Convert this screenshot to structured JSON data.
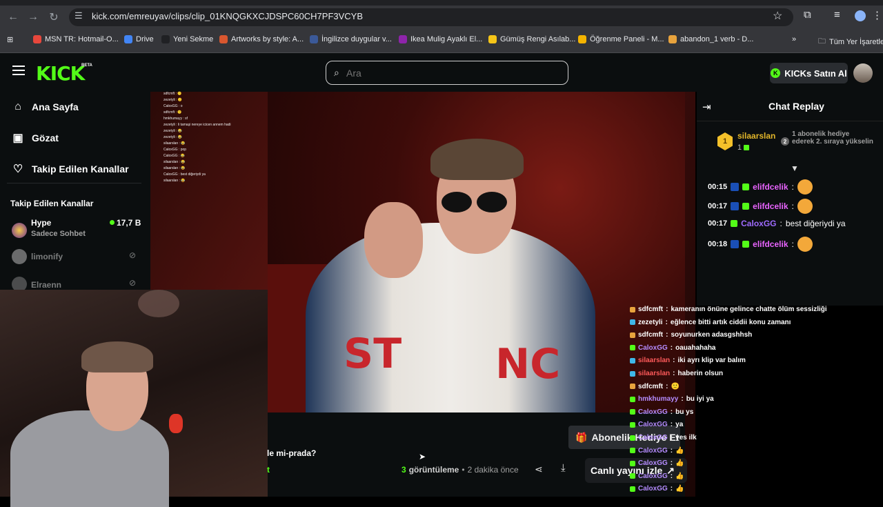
{
  "browser": {
    "url": "kick.com/emreuyav/clips/clip_01KNQGKXCJDSPC60CH7PF3VCYB",
    "bookmarks": [
      {
        "label": "MSN TR: Hotmail-O...",
        "color": "#e7473c"
      },
      {
        "label": "Drive",
        "color": "#4285f4"
      },
      {
        "label": "Yeni Sekme",
        "color": "#202124"
      },
      {
        "label": "Artworks by style: A...",
        "color": "#d9572f"
      },
      {
        "label": "İngilizce duygular v...",
        "color": "#3b5998"
      },
      {
        "label": "Ikea Mulig Ayaklı El...",
        "color": "#8e24aa"
      },
      {
        "label": "Gümüş Rengi Asılab...",
        "color": "#f5c518"
      },
      {
        "label": "Öğrenme Paneli - M...",
        "color": "#f4b400"
      },
      {
        "label": "abandon_1 verb - D...",
        "color": "#e8a33d"
      }
    ],
    "more_bookmarks": "»",
    "all_bookmarks": "Tüm Yer İşaretle"
  },
  "kick": {
    "logo": "KICK",
    "beta": "BETA",
    "search_placeholder": "Ara",
    "kicks_button": "KICKs Satın Al",
    "kicks_icon": "K"
  },
  "sidebar": {
    "items": [
      {
        "label": "Ana Sayfa",
        "icon": "home-icon"
      },
      {
        "label": "Gözat",
        "icon": "browse-icon"
      },
      {
        "label": "Takip Edilen Kanallar",
        "icon": "heart-icon"
      }
    ],
    "section_title": "Takip Edilen Kanallar",
    "channels": [
      {
        "name": "Hype",
        "sub": "Sadece Sohbet",
        "viewers": "17,7 B",
        "live": true
      },
      {
        "name": "limonify",
        "sub": "",
        "viewers": "",
        "live": false
      },
      {
        "name": "Elraenn",
        "sub": "",
        "viewers": "",
        "live": false
      }
    ]
  },
  "clip": {
    "title": "le mi-prada?",
    "extra": "t",
    "views_count": "3",
    "views_label": "görüntüleme",
    "separator": "•",
    "time_ago": "2 dakika önce",
    "watch_live": "Canlı yayını izle",
    "subscribe_button": "Abonelik Hediye Et"
  },
  "mini_chat": [
    "sdfcmft : 😶",
    "zezetyli : 🙂",
    "CaloxGG : o",
    "sdfcmft : 🙂",
    "hmkhumayy : sf",
    "zezetyli : li tamaşi nereye icicen annem hadi",
    "zezetyli : 😂",
    "zezetyli : 😂",
    "silaarslan : 😂",
    "CaloxGG : pop",
    "CaloxGG : 😂",
    "silaarslan : 😂",
    "silaarslan : 😂",
    "CaloxGG : best diğeriydi ya",
    "silaarslan : 😂"
  ],
  "chat": {
    "title": "Chat Replay",
    "gifter": {
      "rank_badge": "1",
      "name": "silaarslan",
      "count": "1",
      "rank": "2",
      "text": "1 abonelik hediye ederek 2. sıraya yükselin"
    },
    "messages": [
      {
        "time": "00:15",
        "user": "elifdcelik",
        "color": "#e964ff",
        "text": ""
      },
      {
        "time": "00:17",
        "user": "elifdcelik",
        "color": "#e964ff",
        "text": ""
      },
      {
        "time": "00:17",
        "user": "CaloxGG",
        "color": "#9f6bff",
        "text": "best diğeriydi ya"
      },
      {
        "time": "00:18",
        "user": "elifdcelik",
        "color": "#e964ff",
        "text": ""
      }
    ]
  },
  "overlay_chat": [
    {
      "user": "sdfcmft",
      "color": "#ffffff",
      "badge": "#e8a33d",
      "text": "kameranın önüne gelince chatte ölüm sessizliği"
    },
    {
      "user": "zezetyli",
      "color": "#ffffff",
      "badge": "#3fb7e8",
      "text": "eğlence bitti artık ciddii konu zamanı"
    },
    {
      "user": "sdfcmft",
      "color": "#ffffff",
      "badge": "#e8a33d",
      "text": "soyunurken adasgshhsh"
    },
    {
      "user": "CaloxGG",
      "color": "#b58cff",
      "badge": "#53fc18",
      "text": "oauahahaha"
    },
    {
      "user": "silaarslan",
      "color": "#ff5a5a",
      "badge": "#3fb7e8",
      "text": "iki ayrı klip var balım"
    },
    {
      "user": "silaarslan",
      "color": "#ff5a5a",
      "badge": "#3fb7e8",
      "text": "haberin olsun"
    },
    {
      "user": "sdfcmft",
      "color": "#ffffff",
      "badge": "#e8a33d",
      "text": "🙂"
    },
    {
      "user": "hmkhumayy",
      "color": "#b58cff",
      "badge": "#53fc18",
      "text": "bu iyi ya"
    },
    {
      "user": "CaloxGG",
      "color": "#b58cff",
      "badge": "#53fc18",
      "text": "bu ys"
    },
    {
      "user": "CaloxGG",
      "color": "#b58cff",
      "badge": "#53fc18",
      "text": "ya"
    },
    {
      "user": "CaloxGG",
      "color": "#b58cff",
      "badge": "#53fc18",
      "text": "yes ilk"
    },
    {
      "user": "CaloxGG",
      "color": "#b58cff",
      "badge": "#53fc18",
      "text": "👍"
    },
    {
      "user": "CaloxGG",
      "color": "#b58cff",
      "badge": "#53fc18",
      "text": "👍"
    },
    {
      "user": "CaloxGG",
      "color": "#b58cff",
      "badge": "#53fc18",
      "text": "👍"
    },
    {
      "user": "CaloxGG",
      "color": "#b58cff",
      "badge": "#53fc18",
      "text": "👍"
    }
  ],
  "colors": {
    "accent": "#53fc18",
    "bg": "#0b0e0f",
    "gifter": "#e2b62a"
  }
}
